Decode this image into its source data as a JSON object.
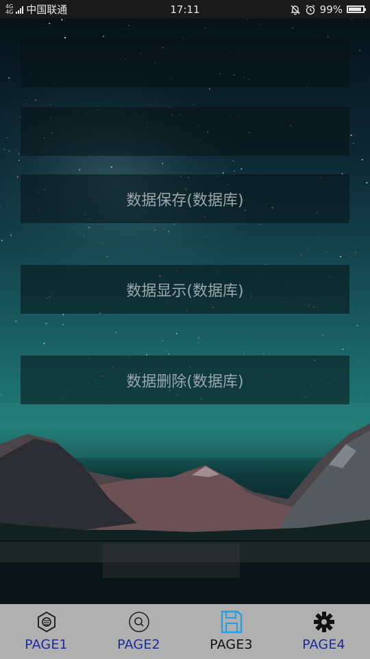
{
  "status_bar": {
    "network": "4G 4G",
    "carrier": "中国联通",
    "time": "17:11",
    "battery_percent": "99%",
    "battery_level": 0.99
  },
  "buttons": [
    {
      "label": ""
    },
    {
      "label": ""
    },
    {
      "label": "数据保存(数据库)"
    },
    {
      "label": "数据显示(数据库)"
    },
    {
      "label": "数据删除(数据库)"
    }
  ],
  "nav": {
    "items": [
      {
        "label": "PAGE1",
        "icon": "hexagon-badge-icon",
        "active": false
      },
      {
        "label": "PAGE2",
        "icon": "circle-search-icon",
        "active": false
      },
      {
        "label": "PAGE3",
        "icon": "save-icon",
        "active": true
      },
      {
        "label": "PAGE4",
        "icon": "gear-icon",
        "active": false
      }
    ],
    "colors": {
      "inactive_label": "#1c2b9a",
      "active_label": "#111111",
      "active_icon": "#2a9de0"
    }
  }
}
